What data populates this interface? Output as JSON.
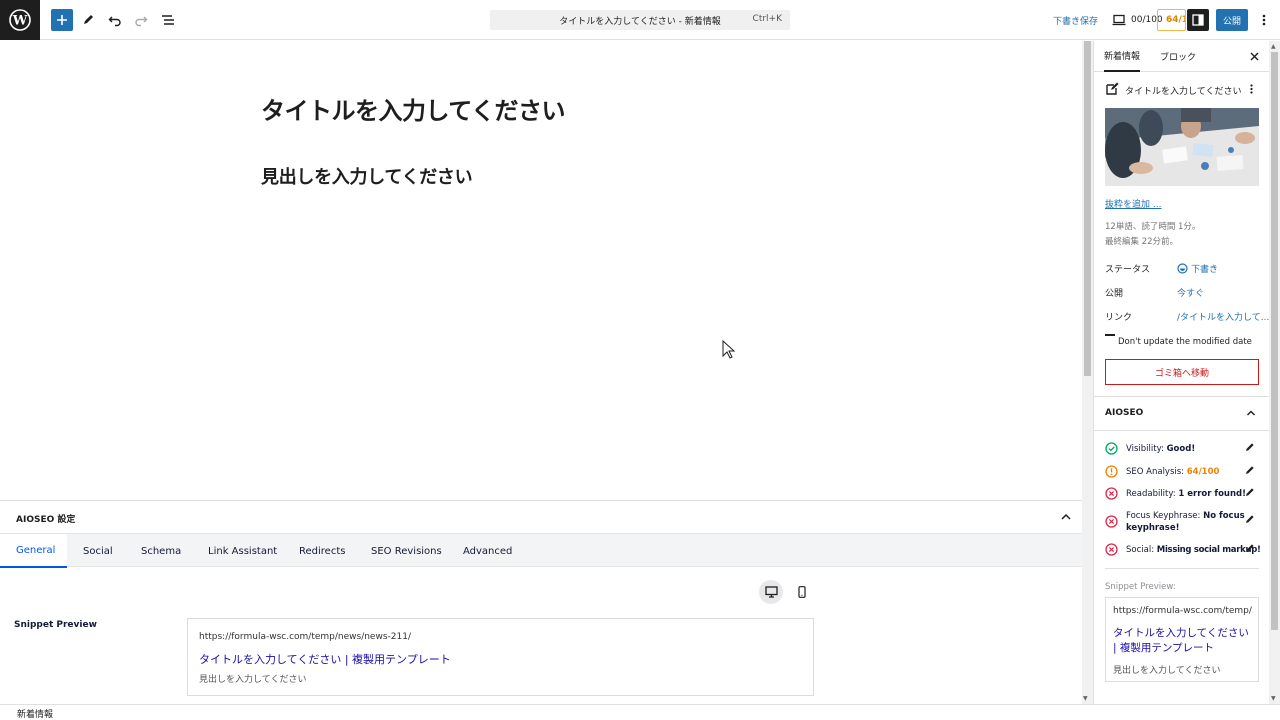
{
  "topbar": {
    "command_bar_text": "タイトルを入力してください - 新着情報",
    "command_shortcut": "Ctrl+K",
    "save_draft": "下書き保存",
    "seo_score_label": "00/100",
    "seo_score_badge": "64/1",
    "publish": "公開"
  },
  "editor": {
    "title": "タイトルを入力してください",
    "heading": "見出しを入力してください"
  },
  "aioseo_panel": {
    "header": "AIOSEO 設定",
    "tabs": [
      "General",
      "Social",
      "Schema",
      "Link Assistant",
      "Redirects",
      "SEO Revisions",
      "Advanced"
    ],
    "snippet_label": "Snippet Preview",
    "snippet": {
      "url": "https://formula-wsc.com/temp/news/news-211/",
      "title": "タイトルを入力してください | 複製用テンプレート",
      "description": "見出しを入力してください"
    }
  },
  "footer": {
    "breadcrumb": "新着情報"
  },
  "sidebar": {
    "tabs": [
      "新着情報",
      "ブロック"
    ],
    "post_title": "タイトルを入力してください",
    "excerpt_link": "抜粋を追加 ...",
    "meta_line1": "12単語、読了時間 1分。",
    "meta_line2": "最終編集 22分前。",
    "rows": [
      {
        "label": "ステータス",
        "value": "下書き"
      },
      {
        "label": "公開",
        "value": "今すぐ"
      },
      {
        "label": "リンク",
        "value": "/タイトルを入力して..."
      }
    ],
    "checkbox_label": "Don't update the modified date",
    "trash_button": "ゴミ箱へ移動",
    "aioseo_title": "AIOSEO",
    "checks": [
      {
        "label": "Visibility: ",
        "value": "Good!",
        "status": "good"
      },
      {
        "label": "SEO Analysis: ",
        "value": "64/100",
        "status": "warning"
      },
      {
        "label": "Readability: ",
        "value": "1 error found!",
        "status": "error"
      },
      {
        "label": "Focus Keyphrase: ",
        "value": "No focus keyphrase!",
        "status": "error"
      },
      {
        "label": "Social: ",
        "value": "Missing social markup!",
        "status": "error"
      }
    ],
    "snippet_label": "Snippet Preview:",
    "snippet": {
      "url": "https://formula-wsc.com/temp/...",
      "title": "タイトルを入力してください | 複製用テンプレート",
      "description": "見出しを入力してください"
    }
  },
  "colors": {
    "accent": "#2271b1",
    "good": "#00aa63",
    "warning": "#f18200",
    "error": "#df2a4a"
  }
}
